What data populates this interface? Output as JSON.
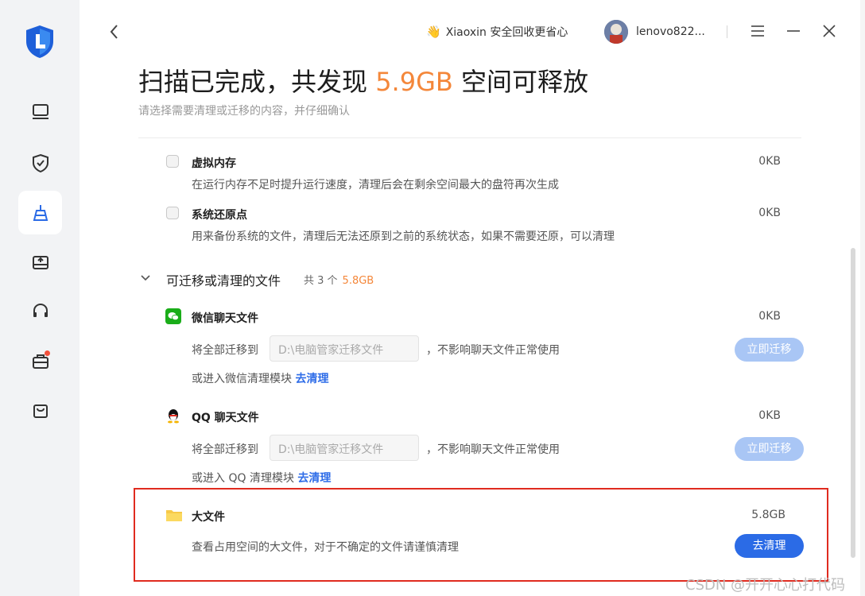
{
  "promo": {
    "text": "Xiaoxin 安全回收更省心"
  },
  "user": {
    "name": "lenovo822..."
  },
  "header": {
    "title_prefix": "扫描已完成，共发现 ",
    "title_size": "5.9GB",
    "title_suffix": " 空间可释放",
    "subtitle": "请选择需要清理或迁移的内容，并仔细确认"
  },
  "items": {
    "virtual_memory": {
      "title": "虚拟内存",
      "desc": "在运行内存不足时提升运行速度，清理后会在剩余空间最大的盘符再次生成",
      "size": "0KB"
    },
    "restore_point": {
      "title": "系统还原点",
      "desc": "用来备份系统的文件，清理后无法还原到之前的系统状态，如果不需要还原，可以清理",
      "size": "0KB"
    }
  },
  "section": {
    "title": "可迁移或清理的文件",
    "count": "共 3 个",
    "size": "5.8GB"
  },
  "wechat": {
    "title": "微信聊天文件",
    "size": "0KB",
    "migrate_label": "将全部迁移到",
    "path": "D:\\电脑管家迁移文件",
    "note": "，不影响聊天文件正常使用",
    "button": "立即迁移",
    "cleanup_prefix": "或进入微信清理模块",
    "cleanup_link": "去清理"
  },
  "qq": {
    "title": "QQ 聊天文件",
    "size": "0KB",
    "migrate_label": "将全部迁移到",
    "path": "D:\\电脑管家迁移文件",
    "note": "，不影响聊天文件正常使用",
    "button": "立即迁移",
    "cleanup_prefix": "或进入 QQ 清理模块",
    "cleanup_link": "去清理"
  },
  "large_files": {
    "title": "大文件",
    "size": "5.8GB",
    "desc": "查看占用空间的大文件，对于不确定的文件请谨慎清理",
    "button": "去清理"
  },
  "watermark": "CSDN @开开心心打代码",
  "colors": {
    "accent": "#2b6be6",
    "size_orange": "#f4873a",
    "highlight_red": "#e02b1f",
    "disabled_btn": "#a9c6f5"
  }
}
